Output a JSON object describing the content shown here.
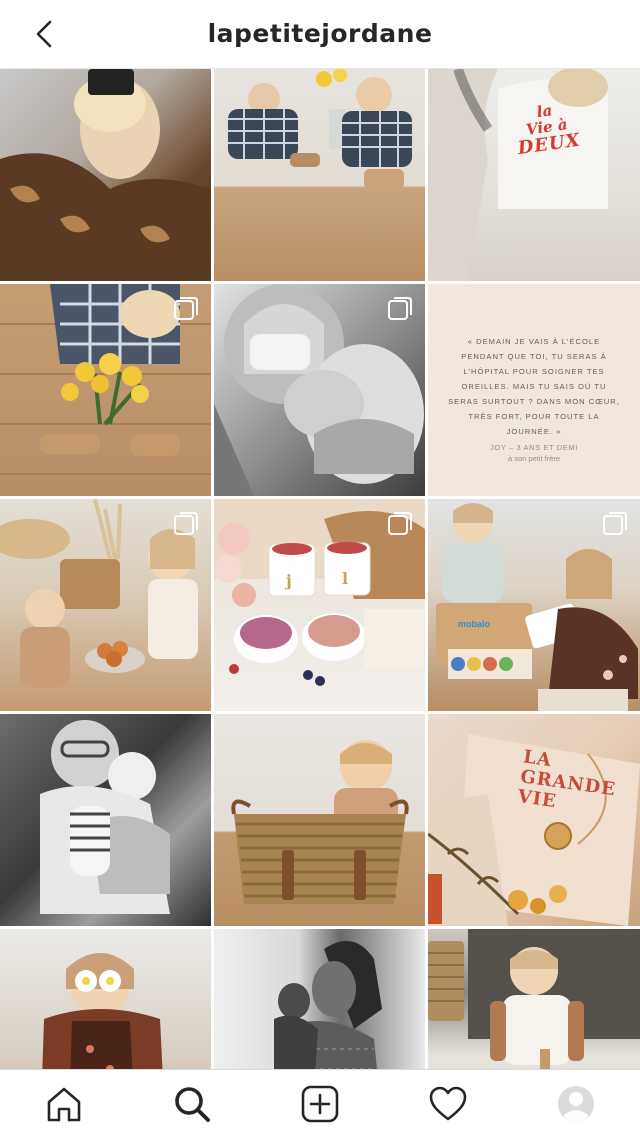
{
  "header": {
    "title": "lapetitejordane",
    "back_icon": "chevron-left-icon"
  },
  "grid": {
    "tiles": [
      {
        "description_icon": "photo",
        "multiple": false
      },
      {
        "description_icon": "photo",
        "multiple": false
      },
      {
        "description_icon": "photo",
        "multiple": false,
        "tshirt_text": [
          "la",
          "Vie à",
          "DEUX"
        ]
      },
      {
        "description_icon": "photo",
        "multiple": true
      },
      {
        "description_icon": "photo",
        "multiple": true
      },
      {
        "description_icon": "photo",
        "multiple": false,
        "quote": "« DEMAIN JE VAIS À L'ÉCOLE PENDANT QUE TOI, TU SERAS À L'HÔPITAL POUR SOIGNER TES OREILLES. MAIS TU SAIS OÙ TU SERAS SURTOUT ? DANS MON CŒUR, TRÈS FORT, POUR TOUTE LA JOURNÉE. »",
        "author": "JOY – 3 ANS ET DEMI",
        "author_sub": "à son petit frère"
      },
      {
        "description_icon": "photo",
        "multiple": true
      },
      {
        "description_icon": "photo",
        "multiple": true,
        "cup_letters": [
          "j",
          "l"
        ]
      },
      {
        "description_icon": "photo",
        "multiple": true,
        "box_logo": "mobalo"
      },
      {
        "description_icon": "photo",
        "multiple": false
      },
      {
        "description_icon": "photo",
        "multiple": false
      },
      {
        "description_icon": "photo",
        "multiple": false,
        "book_title": "LA GRANDE VIE"
      },
      {
        "description_icon": "photo",
        "multiple": false
      },
      {
        "description_icon": "photo",
        "multiple": false
      },
      {
        "description_icon": "photo",
        "multiple": false
      }
    ]
  },
  "bottom_nav": {
    "items": [
      {
        "name": "home-icon"
      },
      {
        "name": "search-icon"
      },
      {
        "name": "add-post-icon"
      },
      {
        "name": "heart-icon"
      },
      {
        "name": "profile-avatar-icon"
      }
    ]
  },
  "colors": {
    "text": "#262626",
    "divider": "#dbdbdb",
    "quote_bg": "#f1e7df",
    "tee_red": "#d9362f"
  }
}
